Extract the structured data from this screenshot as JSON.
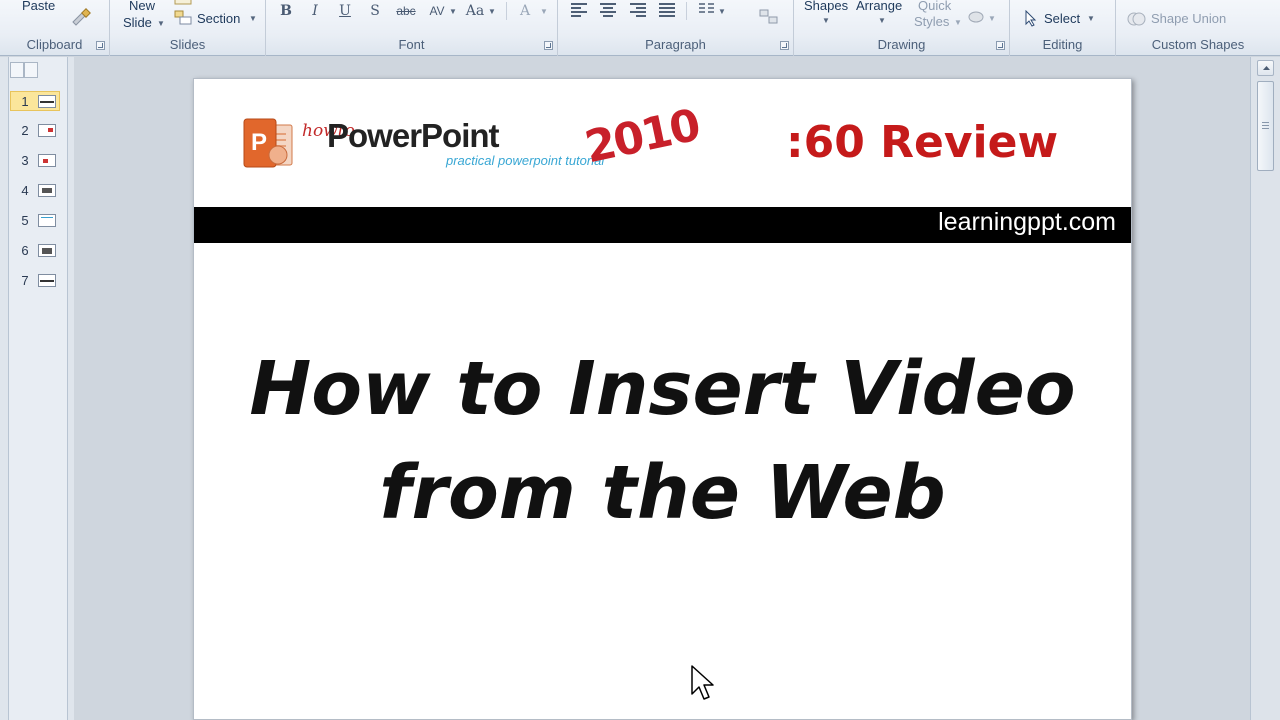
{
  "ribbon": {
    "clipboard": {
      "paste": "Paste",
      "group": "Clipboard"
    },
    "slides": {
      "new_slide_line1": "New",
      "new_slide_line2": "Slide",
      "section": "Section",
      "group": "Slides"
    },
    "font": {
      "group": "Font",
      "bold": "B",
      "italic": "I",
      "underline": "U",
      "shadow": "S",
      "strike": "abc",
      "spacing": "AV",
      "case": "Aa",
      "color": "A"
    },
    "paragraph": {
      "group": "Paragraph"
    },
    "drawing": {
      "shapes": "Shapes",
      "arrange": "Arrange",
      "quick_line1": "Quick",
      "quick_line2": "Styles",
      "group": "Drawing"
    },
    "editing": {
      "select": "Select",
      "group": "Editing"
    },
    "custom": {
      "shape_union": "Shape Union",
      "group": "Custom Shapes"
    }
  },
  "thumbnails": [
    {
      "num": "1",
      "selected": true
    },
    {
      "num": "2"
    },
    {
      "num": "3"
    },
    {
      "num": "4"
    },
    {
      "num": "5"
    },
    {
      "num": "6"
    },
    {
      "num": "7"
    }
  ],
  "slide": {
    "logo_small": "howto",
    "logo_main": "PowerPoint",
    "logo_sub": "practical powerpoint tutorial",
    "logo_year": "2010",
    "review": ":60 Review",
    "banner": "learningppt.com",
    "title_line1": "How to Insert Video",
    "title_line2": "from the Web"
  },
  "colors": {
    "accent_red": "#c51a1a",
    "logo_blue": "#39a7d4",
    "selected_thumb": "#fbe69b",
    "ribbon_label": "#4c607a"
  }
}
